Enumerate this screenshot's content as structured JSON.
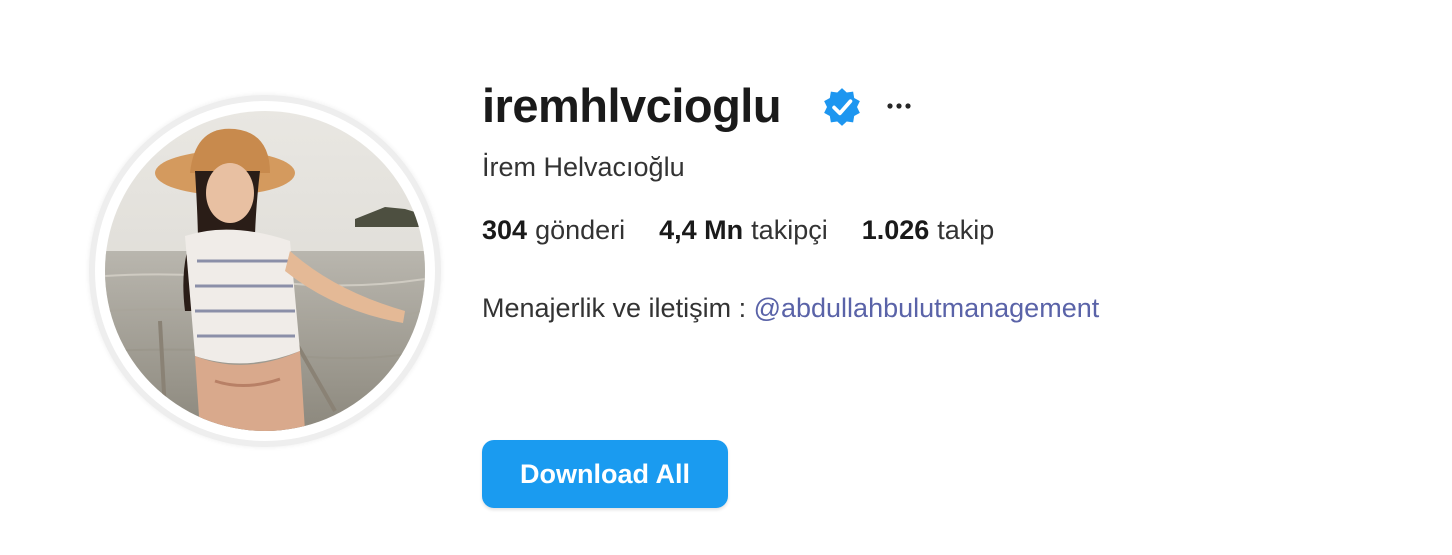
{
  "profile": {
    "username": "iremhlvcioglu",
    "full_name": "İrem Helvacıoğlu",
    "verified_icon": "verified-badge-icon",
    "more_icon": "ellipsis-icon"
  },
  "stats": {
    "posts_count": "304",
    "posts_label": "gönderi",
    "followers_count": "4,4 Mn",
    "followers_label": "takipçi",
    "following_count": "1.026",
    "following_label": "takip"
  },
  "bio": {
    "text": "Menajerlik ve iletişim : ",
    "mention": "@abdullahbulutmanagement"
  },
  "actions": {
    "download_label": "Download All"
  },
  "colors": {
    "accent_button": "#1a9bf0",
    "verified_badge": "#1d96f0",
    "mention_link": "#5a63a8"
  }
}
